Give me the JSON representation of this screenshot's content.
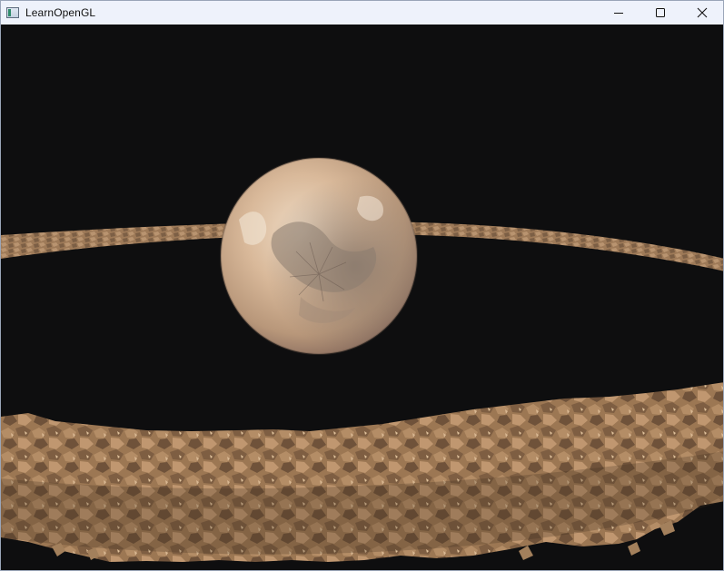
{
  "window": {
    "title": "LearnOpenGL",
    "app_icon": "app-window-icon",
    "controls": [
      {
        "name": "minimize-button",
        "icon": "minimize-icon"
      },
      {
        "name": "maximize-button",
        "icon": "maximize-icon"
      },
      {
        "name": "close-button",
        "icon": "close-icon"
      }
    ]
  },
  "scene": {
    "background": "#0e0e0f",
    "planet_color": "#d8b89a",
    "rock_color": "#9a7552"
  }
}
